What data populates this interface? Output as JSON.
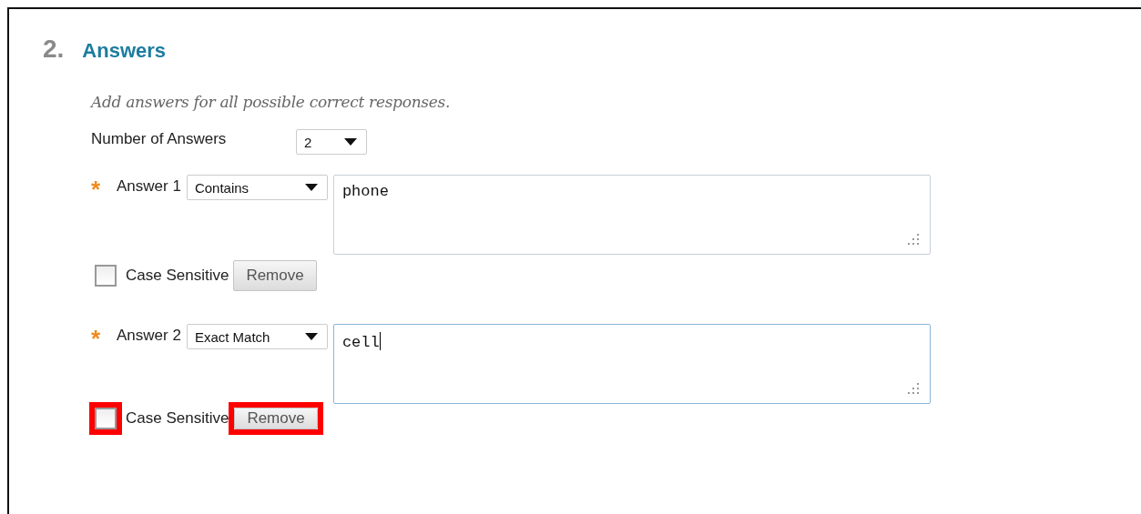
{
  "section": {
    "number": "2.",
    "title": "Answers"
  },
  "instruction": "Add answers for all possible correct responses.",
  "number_of_answers": {
    "label": "Number of Answers",
    "value": "2"
  },
  "answers": [
    {
      "required_mark": "*",
      "label": "Answer 1",
      "match": "Contains",
      "value": "phone",
      "focused": false,
      "case_sensitive": {
        "label": "Case Sensitive",
        "checked": false
      },
      "remove": "Remove",
      "highlighted": false
    },
    {
      "required_mark": "*",
      "label": "Answer 2",
      "match": "Exact Match",
      "value": "cell",
      "focused": true,
      "case_sensitive": {
        "label": "Case Sensitive",
        "checked": false
      },
      "remove": "Remove",
      "highlighted": true
    }
  ]
}
